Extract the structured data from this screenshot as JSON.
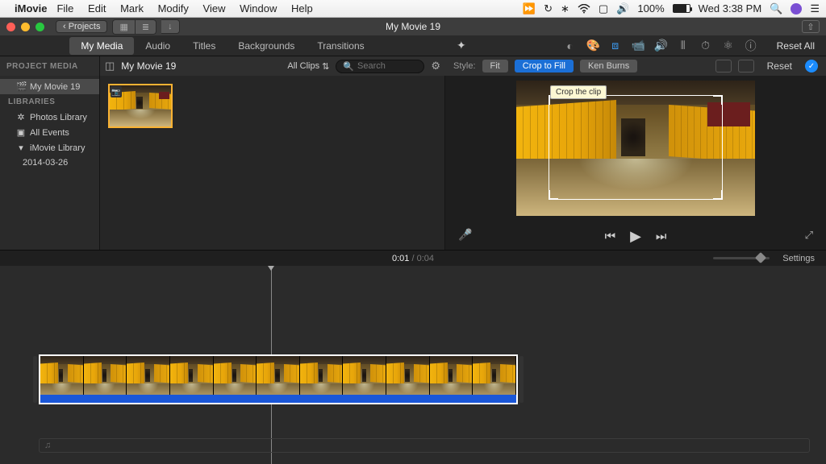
{
  "menubar": {
    "app": "iMovie",
    "items": [
      "File",
      "Edit",
      "Mark",
      "Modify",
      "View",
      "Window",
      "Help"
    ],
    "battery": "100%",
    "clock": "Wed 3:38 PM"
  },
  "titlebar": {
    "projects": "‹ Projects",
    "title": "My Movie 19"
  },
  "tabs": {
    "items": [
      "My Media",
      "Audio",
      "Titles",
      "Backgrounds",
      "Transitions"
    ],
    "active": 0,
    "reset_all": "Reset All"
  },
  "browser_header": {
    "project_media": "PROJECT MEDIA",
    "movie_title": "My Movie 19",
    "clips_filter": "All Clips",
    "search_placeholder": "Search"
  },
  "style_row": {
    "label": "Style:",
    "options": [
      "Fit",
      "Crop to Fill",
      "Ken Burns"
    ],
    "active": 1,
    "reset": "Reset"
  },
  "sidebar": {
    "movie": "My Movie 19",
    "libraries_head": "LIBRARIES",
    "photos": "Photos Library",
    "all_events": "All Events",
    "imovie_lib": "iMovie Library",
    "event_date": "2014-03-26"
  },
  "viewer": {
    "tooltip": "Crop the clip"
  },
  "timeline": {
    "current": "0:01",
    "total": "0:04",
    "settings": "Settings"
  }
}
